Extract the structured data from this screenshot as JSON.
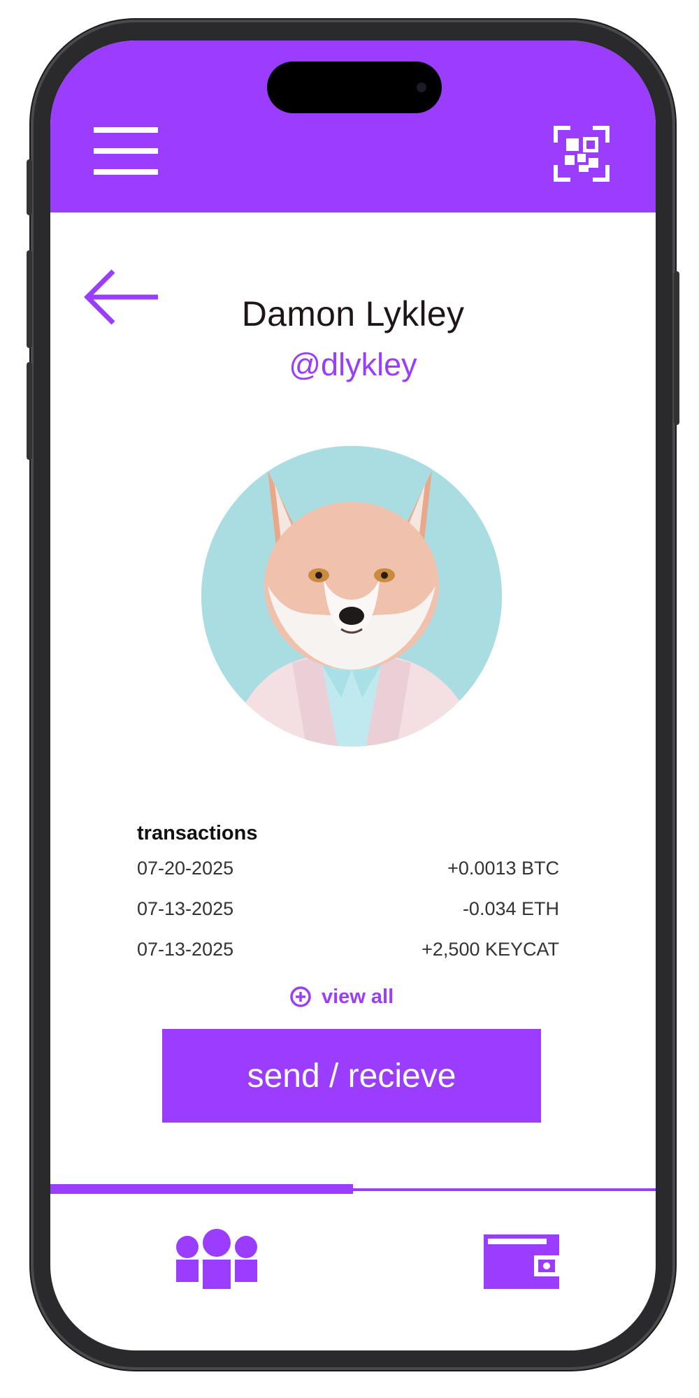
{
  "colors": {
    "accent": "#9a3dff",
    "text": "#1e1616",
    "muted": "#333333"
  },
  "header": {
    "menu_icon": "hamburger-menu-icon",
    "scan_icon": "qr-scan-icon"
  },
  "profile": {
    "back_icon": "arrow-left-icon",
    "name": "Damon Lykley",
    "handle": "@dlykley",
    "avatar": "fox-in-suit-avatar"
  },
  "transactions": {
    "title": "transactions",
    "rows": [
      {
        "date": "07-20-2025",
        "amount": "+0.0013 BTC"
      },
      {
        "date": "07-13-2025",
        "amount": "-0.034 ETH"
      },
      {
        "date": "07-13-2025",
        "amount": "+2,500 KEYCAT"
      }
    ],
    "view_all_label": "view all",
    "view_all_icon": "plus-circle-icon"
  },
  "send_button_label": "send / recieve",
  "bottom_nav": {
    "active_index": 0,
    "tabs": [
      {
        "icon": "people-icon"
      },
      {
        "icon": "wallet-icon"
      }
    ]
  }
}
